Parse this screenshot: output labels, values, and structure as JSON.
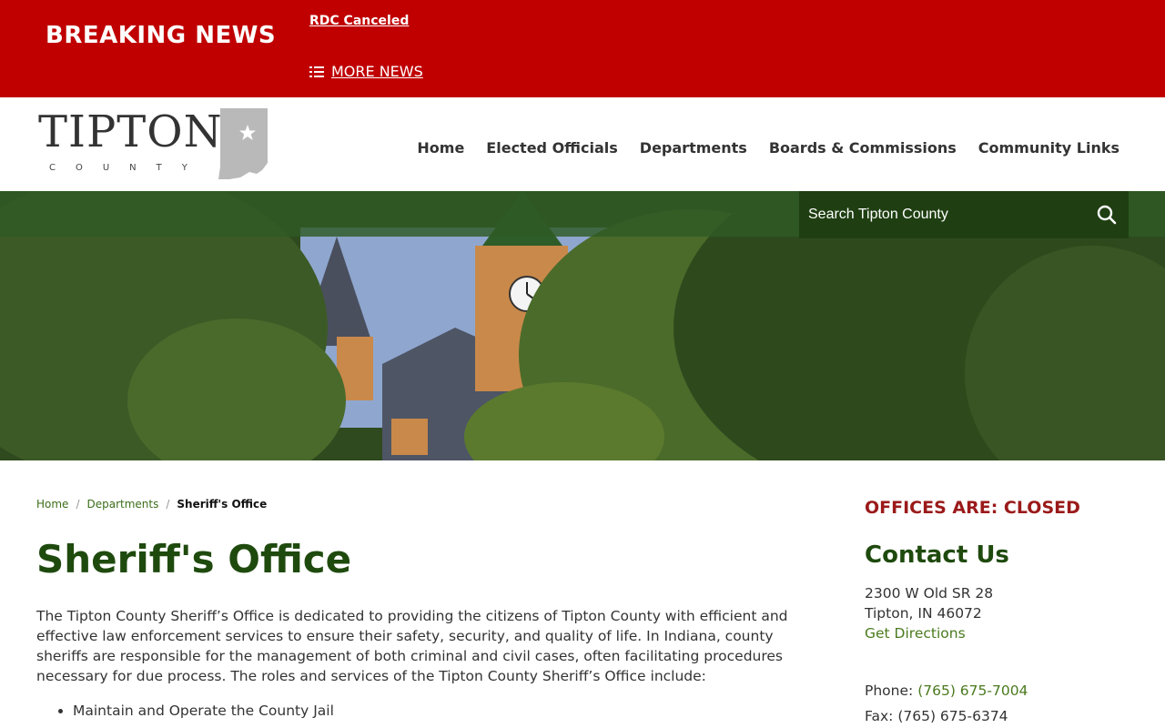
{
  "breaking": {
    "title": "BREAKING NEWS",
    "item": "RDC Canceled",
    "more_label": "MORE NEWS"
  },
  "header": {
    "logo_word": "TIPTON",
    "logo_sub": "COUNTY",
    "nav": [
      "Home",
      "Elected Officials",
      "Departments",
      "Boards & Commissions",
      "Community Links"
    ]
  },
  "search": {
    "placeholder": "Search Tipton County"
  },
  "breadcrumb": {
    "home": "Home",
    "departments": "Departments",
    "current": "Sheriff's Office"
  },
  "main": {
    "title": "Sheriff's Office",
    "intro": "The Tipton County Sheriff’s Office is dedicated to providing the citizens of Tipton County with efficient and effective law enforcement services to ensure their safety, security, and quality of life. In Indiana, county sheriffs are responsible for the management of both criminal and civil cases, often facilitating procedures necessary for due process. The roles and services of the Tipton County Sheriff’s Office include:",
    "bullets": [
      "Maintain and Operate the County Jail"
    ]
  },
  "sidebar": {
    "status": "OFFICES ARE: CLOSED",
    "contact_title": "Contact Us",
    "address_line1": "2300 W Old SR 28",
    "address_line2": "Tipton, IN 46072",
    "directions": "Get Directions",
    "phone_label": "Phone:",
    "phone": "(765) 675-7004",
    "fax": "Fax: (765) 675-6374"
  },
  "colors": {
    "breaking_red": "#c00000",
    "brand_green": "#1f4a0e",
    "link_green": "#4a7a1e",
    "status_red": "#9b1a1a"
  }
}
